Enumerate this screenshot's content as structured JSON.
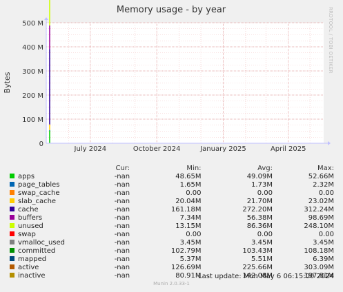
{
  "chart_data": {
    "type": "line",
    "title": "Memory usage - by year",
    "ylabel": "Bytes",
    "ylim": [
      0,
      500000000
    ],
    "y_ticks": [
      {
        "value": 0,
        "label": "0"
      },
      {
        "value": 100000000,
        "label": "100 M"
      },
      {
        "value": 200000000,
        "label": "200 M"
      },
      {
        "value": 300000000,
        "label": "300 M"
      },
      {
        "value": 400000000,
        "label": "400 M"
      },
      {
        "value": 500000000,
        "label": "500 M"
      }
    ],
    "x_range": [
      "2024-05-01",
      "2025-05-20"
    ],
    "x_ticks": [
      {
        "date": "2024-07-01",
        "label": "July 2024"
      },
      {
        "date": "2024-10-01",
        "label": "October 2024"
      },
      {
        "date": "2025-01-01",
        "label": "January 2025"
      },
      {
        "date": "2025-04-01",
        "label": "April 2025"
      }
    ],
    "grid": true,
    "data_span": [
      "2024-05-05",
      "2024-05-06"
    ],
    "series": [
      {
        "name": "apps",
        "color": "#00cc00",
        "cur": "-nan",
        "min": "48.65M",
        "avg": "49.09M",
        "max": "52.66M",
        "peak": 52660000
      },
      {
        "name": "page_tables",
        "color": "#0066b3",
        "cur": "-nan",
        "min": "1.65M",
        "avg": "1.73M",
        "max": "2.32M",
        "peak": 2320000
      },
      {
        "name": "swap_cache",
        "color": "#ff8000",
        "cur": "-nan",
        "min": "0.00",
        "avg": "0.00",
        "max": "0.00",
        "peak": 0
      },
      {
        "name": "slab_cache",
        "color": "#ffcc00",
        "cur": "-nan",
        "min": "20.04M",
        "avg": "21.70M",
        "max": "23.02M",
        "peak": 23020000
      },
      {
        "name": "cache",
        "color": "#330099",
        "cur": "-nan",
        "min": "161.18M",
        "avg": "272.20M",
        "max": "312.24M",
        "peak": 312240000
      },
      {
        "name": "buffers",
        "color": "#990099",
        "cur": "-nan",
        "min": "7.34M",
        "avg": "56.38M",
        "max": "98.69M",
        "peak": 98690000
      },
      {
        "name": "unused",
        "color": "#ccff00",
        "cur": "-nan",
        "min": "13.15M",
        "avg": "86.36M",
        "max": "248.10M",
        "peak": 248100000
      },
      {
        "name": "swap",
        "color": "#ff0000",
        "cur": "-nan",
        "min": "0.00",
        "avg": "0.00",
        "max": "0.00",
        "peak": 0
      },
      {
        "name": "vmalloc_used",
        "color": "#808080",
        "cur": "-nan",
        "min": "3.45M",
        "avg": "3.45M",
        "max": "3.45M",
        "peak": 3450000
      },
      {
        "name": "committed",
        "color": "#008f00",
        "cur": "-nan",
        "min": "102.79M",
        "avg": "103.43M",
        "max": "108.18M",
        "peak": 108180000
      },
      {
        "name": "mapped",
        "color": "#00487d",
        "cur": "-nan",
        "min": "5.37M",
        "avg": "5.51M",
        "max": "6.39M",
        "peak": 6390000
      },
      {
        "name": "active",
        "color": "#b35a00",
        "cur": "-nan",
        "min": "126.69M",
        "avg": "225.66M",
        "max": "303.09M",
        "peak": 303090000
      },
      {
        "name": "inactive",
        "color": "#b38f00",
        "cur": "-nan",
        "min": "80.91M",
        "avg": "142.08M",
        "max": "197.81M",
        "peak": 197810000
      }
    ],
    "stack_total_peak": 500000000
  },
  "legend_header": {
    "cur": "Cur:",
    "min": "Min:",
    "avg": "Avg:",
    "max": "Max:"
  },
  "last_update": "Last update:  Mon May  6 06:15:00 2024",
  "footer": "Munin 2.0.33-1",
  "watermark": "RRDTOOL / TOBI OETIKER"
}
